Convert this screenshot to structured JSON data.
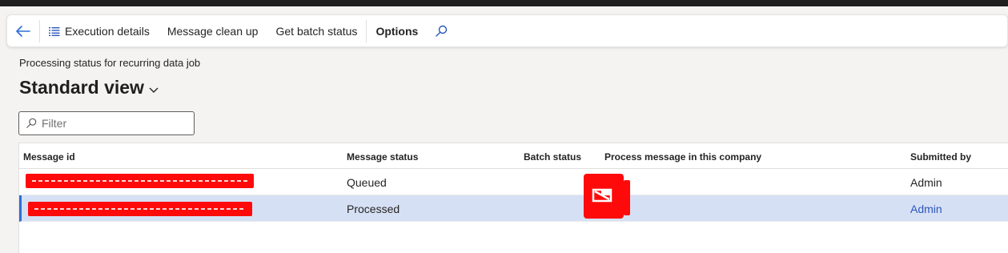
{
  "actions": {
    "back_icon": "arrow-left",
    "execution_details": "Execution details",
    "message_cleanup": "Message clean up",
    "batch_status": "Get batch status",
    "options": "Options",
    "search_icon": "search"
  },
  "page": {
    "caption": "Processing status for recurring data job",
    "view_name": "Standard view"
  },
  "filter": {
    "placeholder": "Filter"
  },
  "grid": {
    "columns": [
      "Message id",
      "Message status",
      "Batch status",
      "Process message in this company",
      "Submitted by"
    ],
    "rows": [
      {
        "message_id": "",
        "status": "Queued",
        "batch_status": "",
        "submitted_by": "Admin",
        "selected": false
      },
      {
        "message_id": "",
        "status": "Processed",
        "batch_status": "",
        "submitted_by": "Admin",
        "selected": true
      }
    ]
  },
  "colors": {
    "accent": "#2b6fd6",
    "selected_row": "#d6e0f5",
    "redaction": "#ff0a0a"
  }
}
